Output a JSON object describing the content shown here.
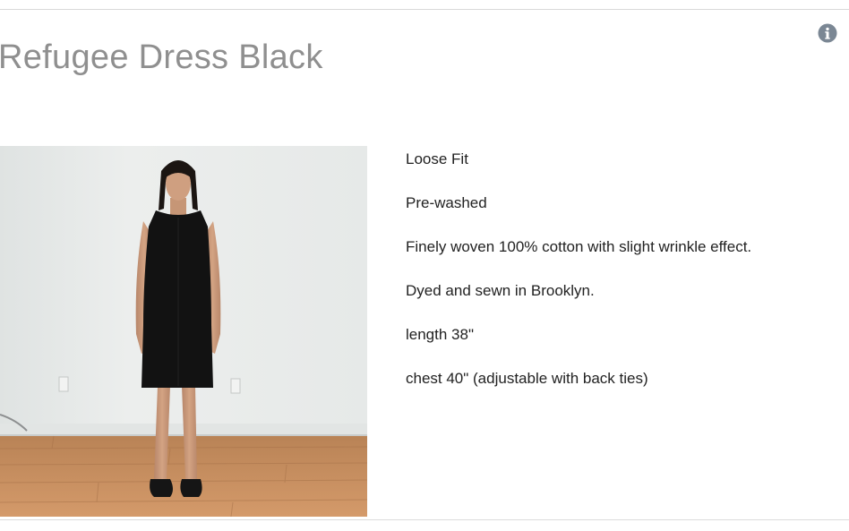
{
  "product": {
    "title": "Refugee Dress Black",
    "info_icon": "info-icon",
    "image": {
      "subject": "model-in-black-sleeveless-dress",
      "colors": {
        "wall": "#eceeed",
        "floor": "#c98a5a",
        "dress": "#121212"
      }
    },
    "details": [
      "Loose Fit",
      "Pre-washed",
      "Finely woven 100% cotton with slight wrinkle effect.",
      "Dyed and sewn in Brooklyn.",
      "length 38\"",
      "chest 40\" (adjustable with back ties)"
    ]
  },
  "colors": {
    "title": "#8f8f8f",
    "text": "#222222",
    "info_icon": "#7b8794",
    "rule": "#d9d9d9"
  }
}
